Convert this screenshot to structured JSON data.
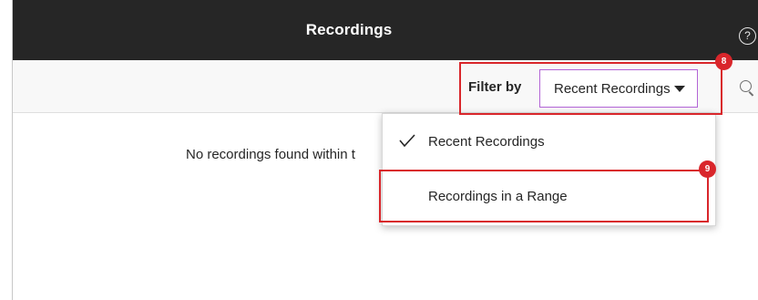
{
  "header": {
    "title": "Recordings",
    "help_icon": "question-circle-icon"
  },
  "filter": {
    "label": "Filter by",
    "selected": "Recent Recordings",
    "caret_icon": "caret-down-icon",
    "search_icon": "search-icon"
  },
  "main": {
    "empty_message": "No recordings found within t"
  },
  "dropdown": {
    "items": [
      {
        "label": "Recent Recordings",
        "checked": true
      },
      {
        "label": "Recordings in a Range",
        "checked": false
      }
    ]
  },
  "annotations": [
    {
      "number": "8",
      "color": "#d9262b"
    },
    {
      "number": "9",
      "color": "#d9262b"
    }
  ],
  "colors": {
    "header_bg": "#262626",
    "select_focus_border": "#b264d6",
    "annotation_red": "#d9262b"
  }
}
